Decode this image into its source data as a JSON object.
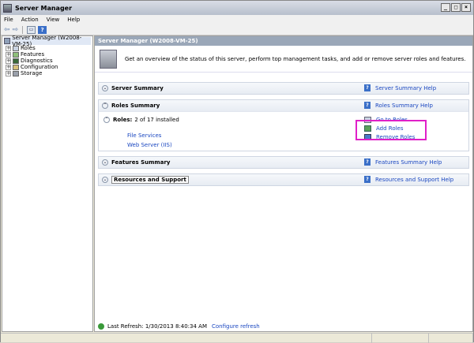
{
  "window": {
    "title": "Server Manager",
    "min": "_",
    "max": "□",
    "close": "×"
  },
  "menu": [
    "File",
    "Action",
    "View",
    "Help"
  ],
  "toolbar": {
    "back": "⇦",
    "forward": "⇨",
    "help": "?",
    "console": "▭"
  },
  "tree": {
    "root": "Server Manager (W2008-VM-25)",
    "items": [
      {
        "label": "Roles",
        "expander": "+"
      },
      {
        "label": "Features",
        "expander": "+"
      },
      {
        "label": "Diagnostics",
        "expander": "+"
      },
      {
        "label": "Configuration",
        "expander": "+"
      },
      {
        "label": "Storage",
        "expander": "+"
      }
    ]
  },
  "main": {
    "header": "Server Manager (W2008-VM-25)",
    "banner": "Get an overview of the status of this server, perform top management tasks, and add or remove server roles and features.",
    "sections": {
      "server_summary": {
        "title": "Server Summary",
        "help": "Server Summary Help",
        "chevron": "⌄"
      },
      "roles_summary": {
        "title": "Roles Summary",
        "help": "Roles Summary Help",
        "chevron": "⌃"
      },
      "features_summary": {
        "title": "Features Summary",
        "help": "Features Summary Help",
        "chevron": "⌄"
      },
      "resources": {
        "title": "Resources and Support",
        "help": "Resources and Support Help",
        "chevron": "⌄"
      }
    },
    "roles": {
      "label": "Roles:",
      "count": "2 of 17 installed",
      "chevron": "⌃",
      "installed": [
        "File Services",
        "Web Server (IIS)"
      ],
      "actions": [
        "Go to Roles",
        "Add Roles",
        "Remove Roles"
      ]
    },
    "footer": {
      "last_refresh": "Last Refresh: 1/30/2013 8:40:34 AM",
      "configure": "Configure refresh"
    }
  },
  "colors": {
    "highlight": "#e020c8",
    "link": "#1a47c0",
    "header_bg": "#9aa7b8"
  }
}
